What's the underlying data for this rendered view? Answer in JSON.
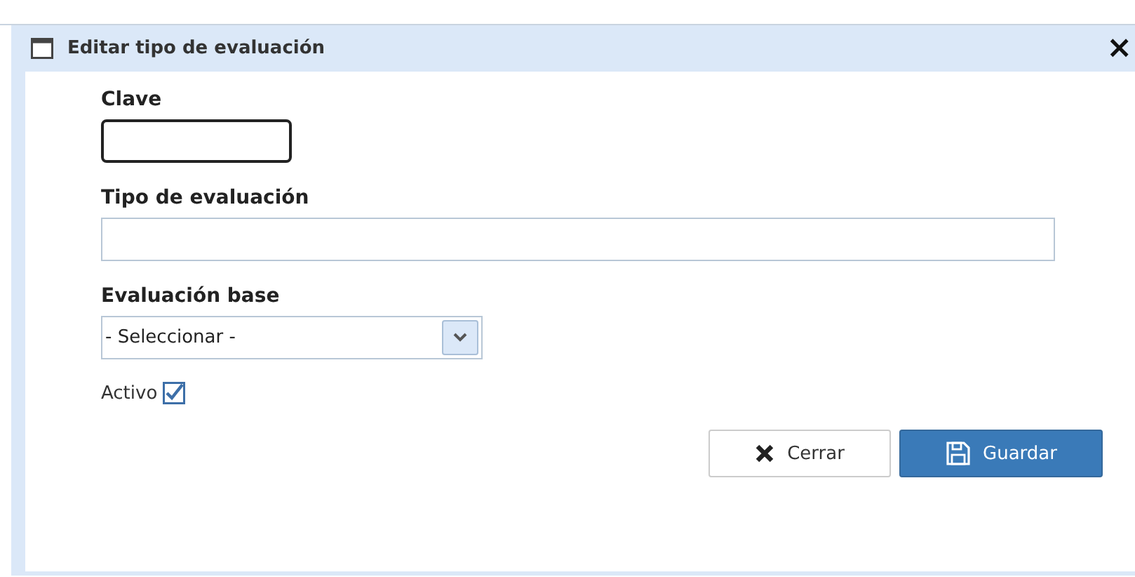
{
  "dialog": {
    "title": "Editar tipo de evaluación",
    "close": "×"
  },
  "fields": [
    {
      "label": "Clave",
      "focused": true
    },
    {
      "label": "Tipo de evaluación",
      "focused": false
    }
  ],
  "select": {
    "label": "Evaluación base",
    "value": "- Seleccionar -"
  },
  "active": {
    "label": "Activo",
    "checked": true
  },
  "buttons": [
    {
      "label": "Cerrar",
      "kind": "close"
    },
    {
      "label": "Guardar",
      "kind": "save"
    }
  ]
}
